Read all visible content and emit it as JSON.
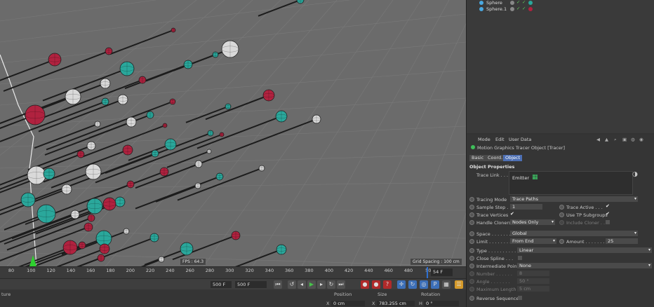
{
  "viewport": {
    "fps": "FPS : 64.3",
    "grid_spacing": "Grid Spacing : 100 cm"
  },
  "timeline": {
    "ticks": [
      "80",
      "100",
      "120",
      "140",
      "160",
      "180",
      "200",
      "220",
      "240",
      "260",
      "280",
      "300",
      "320",
      "340",
      "360",
      "380",
      "400",
      "420",
      "440",
      "460",
      "480",
      "50"
    ],
    "current_frame": "54 F"
  },
  "transport": {
    "start_field": "500 F",
    "end_field": "500 F"
  },
  "bottom": {
    "left_label": "ture",
    "position_header": "Position",
    "size_header": "Size",
    "rotation_header": "Rotation",
    "x_label": "X",
    "x_position": "0 cm",
    "x_size_label": "X",
    "x_size": "783.255 cm",
    "h_label": "H",
    "h_rotation": "0 °"
  },
  "object_manager": {
    "rows": [
      {
        "name": "Sphere"
      },
      {
        "name": "Sphere.1"
      }
    ]
  },
  "attributes": {
    "menu": [
      "Mode",
      "Edit",
      "User Data"
    ],
    "object_title": "Motion Graphics Tracer Object [Tracer]",
    "tabs": [
      "Basic",
      "Coord.",
      "Object"
    ],
    "section": "Object Properties",
    "trace_link_label": "Trace Link . . .",
    "trace_link_item": "Emitter",
    "tracing_mode_label": "Tracing Mode",
    "tracing_mode_value": "Trace Paths",
    "sample_step_label": "Sample Step . .",
    "sample_step_value": "1",
    "trace_active_label": "Trace Active . . .",
    "trace_vertices_label": "Trace Vertices",
    "use_tp_label": "Use TP Subgroups",
    "handle_cloners_label": "Handle Cloners",
    "handle_cloners_value": "Nodes Only",
    "include_cloner_label": "Include Cloner . .",
    "space_label": "Space . . . . . . .",
    "space_value": "Global",
    "limit_label": "Limit . . . . . . . .",
    "limit_value": "From End",
    "amount_label": "Amount . . . . . . .",
    "amount_value": "25",
    "type_label": "Type . . . . . . . . . .",
    "type_value": "Linear",
    "close_spline_label": "Close Spline . . .",
    "intermediate_label": "Intermediate Points",
    "intermediate_value": "None",
    "number_label": "Number . . . . . .",
    "number_value": "8",
    "angle_label": "Angle . . . . . . .",
    "angle_value": "50 °",
    "max_length_label": "Maximum Length .",
    "max_length_value": "5 cm",
    "reverse_label": "Reverse Sequence"
  },
  "colors": {
    "teal": "#2aa79b",
    "red": "#b0223f",
    "white": "#d9d9d9",
    "accent": "#4d6fb3"
  }
}
